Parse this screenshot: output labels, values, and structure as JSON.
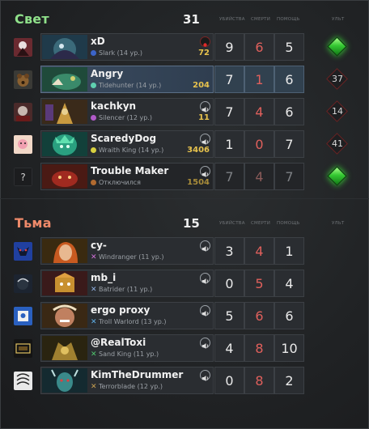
{
  "radiant": {
    "name": "Свет",
    "score": "31",
    "name_color": "#8fe08a",
    "col_kills": "убийства",
    "col_deaths": "смерти",
    "col_assists": "помощь",
    "col_ult": "ульт",
    "players": [
      {
        "name": "xD",
        "hero": "Slark",
        "level": "(14 ур.)",
        "gold": "72",
        "kills": "9",
        "deaths": "6",
        "assists": "5",
        "ult": "ready",
        "ult_text": "",
        "dot": "#3c64c8",
        "voice": "record-icon"
      },
      {
        "name": "Angry",
        "hero": "Tidehunter",
        "level": "(14 ур.)",
        "gold": "204",
        "kills": "7",
        "deaths": "1",
        "assists": "6",
        "ult": "cooldown",
        "ult_text": "37",
        "dot": "#5fd0b0",
        "voice": "none"
      },
      {
        "name": "kachkyn",
        "hero": "Silencer",
        "level": "(12 ур.)",
        "gold": "11",
        "kills": "7",
        "deaths": "4",
        "assists": "6",
        "ult": "cooldown",
        "ult_text": "14",
        "dot": "#b05ac8",
        "voice": "speaker-icon"
      },
      {
        "name": "ScaredyDog",
        "hero": "Wraith King",
        "level": "(14 ур.)",
        "gold": "3406",
        "kills": "1",
        "deaths": "0",
        "assists": "7",
        "ult": "cooldown",
        "ult_text": "41",
        "dot": "#d8d040",
        "voice": "speaker-icon"
      },
      {
        "name": "Trouble Maker",
        "hero": "Отключился",
        "level": "",
        "gold": "1504",
        "kills": "7",
        "deaths": "4",
        "assists": "7",
        "ult": "ready",
        "ult_text": "",
        "dot": "#b06a30",
        "voice": "speaker-icon",
        "disconnected": true
      }
    ]
  },
  "dire": {
    "name": "Тьма",
    "score": "15",
    "name_color": "#ef8a6a",
    "col_kills": "убийства",
    "col_deaths": "смерти",
    "col_assists": "помощь",
    "col_ult": "ульт",
    "players": [
      {
        "name": "cy-",
        "hero": "Windranger",
        "level": "(11 ур.)",
        "kills": "3",
        "deaths": "4",
        "assists": "1",
        "x_color": "#d070d8",
        "voice": "speaker-icon"
      },
      {
        "name": "mb_i",
        "hero": "Batrider",
        "level": "(11 ур.)",
        "kills": "0",
        "deaths": "5",
        "assists": "4",
        "x_color": "#8fb0e0",
        "voice": "speaker-icon"
      },
      {
        "name": "ergo proxy",
        "hero": "Troll Warlord",
        "level": "(13 ур.)",
        "kills": "5",
        "deaths": "6",
        "assists": "6",
        "x_color": "#5fb0e8",
        "voice": "speaker-icon"
      },
      {
        "name": "@RealToxi",
        "hero": "Sand King",
        "level": "(11 ур.)",
        "kills": "4",
        "deaths": "8",
        "assists": "10",
        "x_color": "#4fc46c",
        "voice": "speaker-icon"
      },
      {
        "name": "KimTheDrummer",
        "hero": "Terrorblade",
        "level": "(12 ур.)",
        "kills": "0",
        "deaths": "8",
        "assists": "2",
        "x_color": "#c8a050",
        "voice": "speaker-icon"
      }
    ]
  }
}
